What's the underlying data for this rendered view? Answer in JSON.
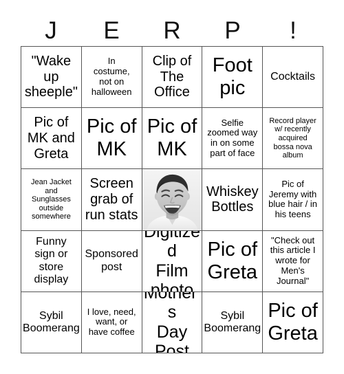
{
  "card": {
    "header_letters": [
      "J",
      "E",
      "R",
      "P",
      "!"
    ],
    "rows": [
      [
        {
          "text": "\"Wake\nup\nsheeple\"",
          "size": "lg",
          "type": "text"
        },
        {
          "text": "In\ncostume,\nnot on\nhalloween",
          "size": "sm",
          "type": "text"
        },
        {
          "text": "Clip of\nThe\nOffice",
          "size": "lg",
          "type": "text"
        },
        {
          "text": "Foot\npic",
          "size": "xxl",
          "type": "text"
        },
        {
          "text": "Cocktails",
          "size": "md",
          "type": "text"
        }
      ],
      [
        {
          "text": "Pic of\nMK and\nGreta",
          "size": "lg",
          "type": "text"
        },
        {
          "text": "Pic of\nMK",
          "size": "xxl",
          "type": "text"
        },
        {
          "text": "Pic of\nMK",
          "size": "xxl",
          "type": "text"
        },
        {
          "text": "Selfie\nzoomed way\nin on some\npart of face",
          "size": "sm",
          "type": "text"
        },
        {
          "text": "Record player\nw/ recently\nacquired\nbossa nova\nalbum",
          "size": "xs",
          "type": "text"
        }
      ],
      [
        {
          "text": "Jean Jacket\nand\nSunglasses\noutside\nsomewhere",
          "size": "xs",
          "type": "text"
        },
        {
          "text": "Screen\ngrab of\nrun stats",
          "size": "lg",
          "type": "text"
        },
        {
          "text": "",
          "size": "md",
          "type": "photo",
          "photo_alt": "black-and-white photo of a laughing man"
        },
        {
          "text": "Whiskey\nBottles",
          "size": "lg",
          "type": "text"
        },
        {
          "text": "Pic of\nJeremy with\nblue hair / in\nhis teens",
          "size": "sm",
          "type": "text"
        }
      ],
      [
        {
          "text": "Funny\nsign or\nstore\ndisplay",
          "size": "md",
          "type": "text"
        },
        {
          "text": "Sponsored\npost",
          "size": "md",
          "type": "text"
        },
        {
          "text": "Digitized\nFilm\nphoto",
          "size": "xl",
          "type": "text"
        },
        {
          "text": "Pic of\nGreta",
          "size": "xxl",
          "type": "text"
        },
        {
          "text": "\"Check out\nthis article I\nwrote for\nMen's\nJournal\"",
          "size": "sm",
          "type": "text"
        }
      ],
      [
        {
          "text": "Sybil\nBoomerang",
          "size": "md",
          "type": "text"
        },
        {
          "text": "I love, need,\nwant, or\nhave coffee",
          "size": "sm",
          "type": "text"
        },
        {
          "text": "Mother's\nDay\nPost",
          "size": "xl",
          "type": "text"
        },
        {
          "text": "Sybil\nBoomerang",
          "size": "md",
          "type": "text"
        },
        {
          "text": "Pic of\nGreta",
          "size": "xxl",
          "type": "text"
        }
      ]
    ]
  },
  "colors": {
    "background": "#ffffff",
    "text": "#000000",
    "grid_line": "#555555"
  }
}
